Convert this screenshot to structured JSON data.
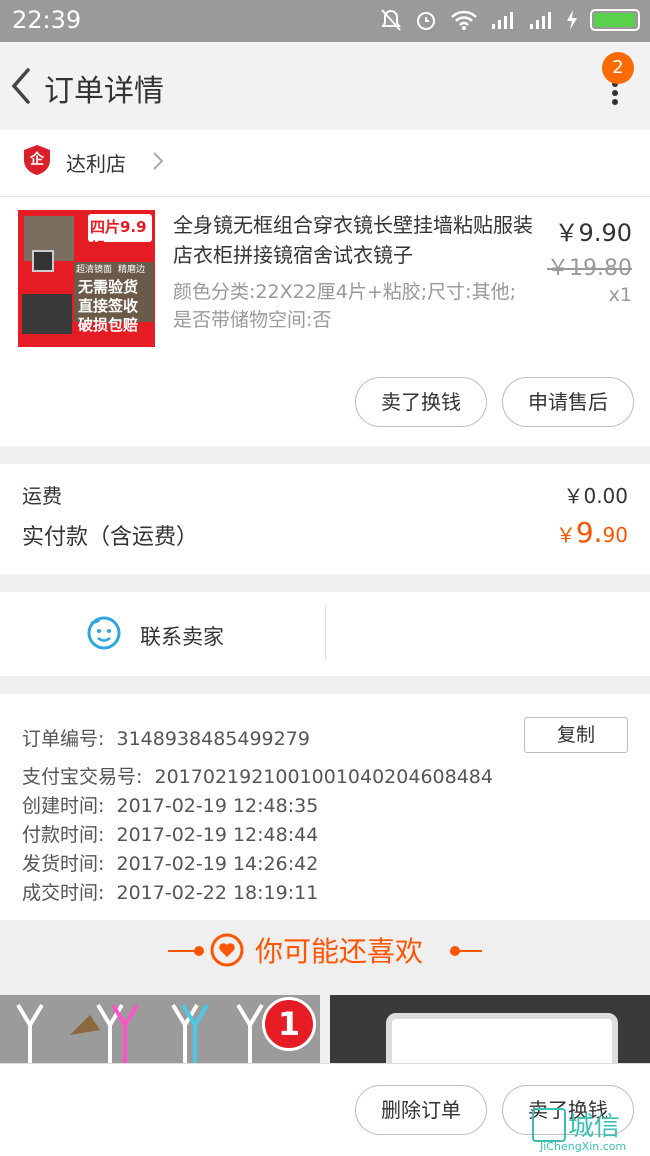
{
  "status_bar": {
    "time": "22:39"
  },
  "header": {
    "title": "订单详情",
    "badge": "2"
  },
  "shop": {
    "name": "达利店",
    "icon_text": "企"
  },
  "product": {
    "name": "全身镜无框组合穿衣镜长壁挂墙粘贴服装店衣柜拼接镜宿舍试衣镜子",
    "sku": "颜色分类:22X22厘4片+粘胶;尺寸:其他;是否带储物空间:否",
    "price": "￥9.90",
    "original_price": "￥19.80",
    "quantity": "x1",
    "image_text": {
      "banner": "四片9.9起",
      "small_left": "超清镜面",
      "small_right": "精磨边",
      "lines": [
        "无需验货",
        "直接签收",
        "破损包赔"
      ]
    }
  },
  "actions": {
    "sell_button": "卖了换钱",
    "aftersale_button": "申请售后"
  },
  "fees": {
    "shipping_label": "运费",
    "shipping_value": "￥0.00",
    "paid_label": "实付款（含运费）",
    "paid_symbol": "￥",
    "paid_int": "9.",
    "paid_dec": "90"
  },
  "contact": {
    "label": "联系卖家"
  },
  "order_info": {
    "copy_button": "复制",
    "rows": [
      {
        "key": "订单编号:",
        "value": "3148938485499279"
      },
      {
        "key": "支付宝交易号:",
        "value": "2017021921001001040204608484"
      },
      {
        "key": "创建时间:",
        "value": "2017-02-19 12:48:35"
      },
      {
        "key": "付款时间:",
        "value": "2017-02-19 12:48:44"
      },
      {
        "key": "发货时间:",
        "value": "2017-02-19 14:26:42"
      },
      {
        "key": "成交时间:",
        "value": "2017-02-22 18:19:11"
      }
    ]
  },
  "recommend": {
    "title": "你可能还喜欢",
    "thumb_badge": "1"
  },
  "footer": {
    "delete_button": "删除订单",
    "sell_button": "卖了换钱"
  },
  "watermark": {
    "brand": "城信",
    "url": "JiChengXin.com"
  },
  "colors": {
    "accent": "#ff5500",
    "badge": "#ff6a00",
    "shop_icon": "#d9202a",
    "contact_icon": "#2ea7e0"
  }
}
